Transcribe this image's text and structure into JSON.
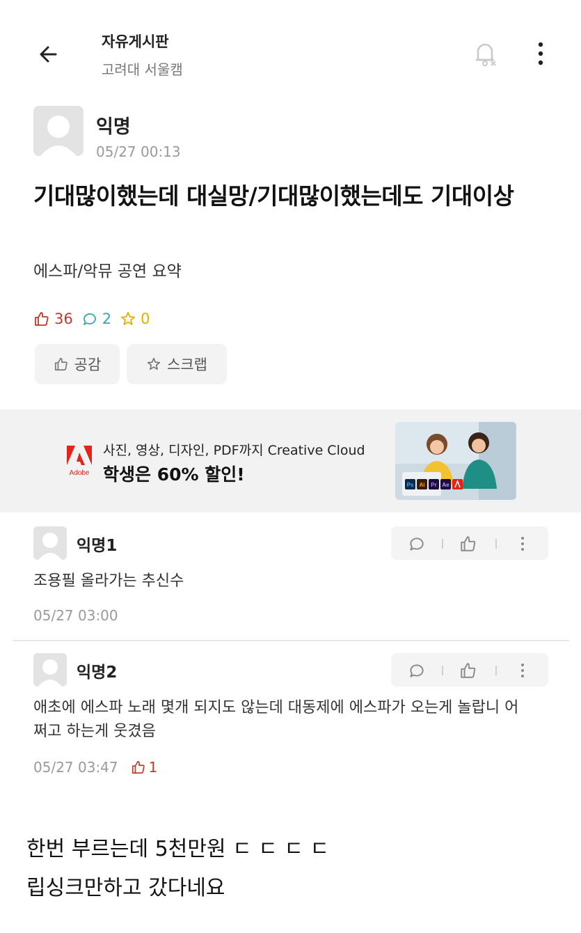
{
  "header": {
    "title": "자유게시판",
    "subtitle": "고려대 서울캠",
    "icons": {
      "back": "back-arrow-icon",
      "bell": "bell-off-icon",
      "more": "more-vertical-icon"
    }
  },
  "post": {
    "author": "익명",
    "time": "05/27 00:13",
    "title": "기대많이했는데 대실망/기대많이했는데도 기대이상",
    "body": "에스파/악뮤 공연 요약",
    "likes": "36",
    "comments": "2",
    "scraps": "0",
    "like_button": "공감",
    "scrap_button": "스크랩"
  },
  "ad": {
    "brand": "Adobe",
    "line1": "사진, 영상, 디자인, PDF까지 Creative Cloud",
    "line2": "학생은 60% 할인!",
    "app_badges": [
      "Ps",
      "Ai",
      "Pr",
      "Ae"
    ]
  },
  "comments": [
    {
      "author": "익명1",
      "text": "조용필 올라가는 추신수",
      "time": "05/27 03:00",
      "likes": ""
    },
    {
      "author": "익명2",
      "text": "애초에 에스파 노래 몇개 되지도 않는데 대동제에 에스파가 오는게 놀랍니 어쩌고 하는게 웃겼음",
      "time": "05/27 03:47",
      "likes": "1"
    }
  ],
  "caption": {
    "line1": "한번 부르는데 5천만원 ㄷ ㄷ ㄷ ㄷ",
    "line2": "립싱크만하고 갔다네요"
  },
  "colors": {
    "like": "#c0392b",
    "comment": "#2fa8b6",
    "scrap": "#e0b000",
    "adobe": "#e1251b"
  }
}
